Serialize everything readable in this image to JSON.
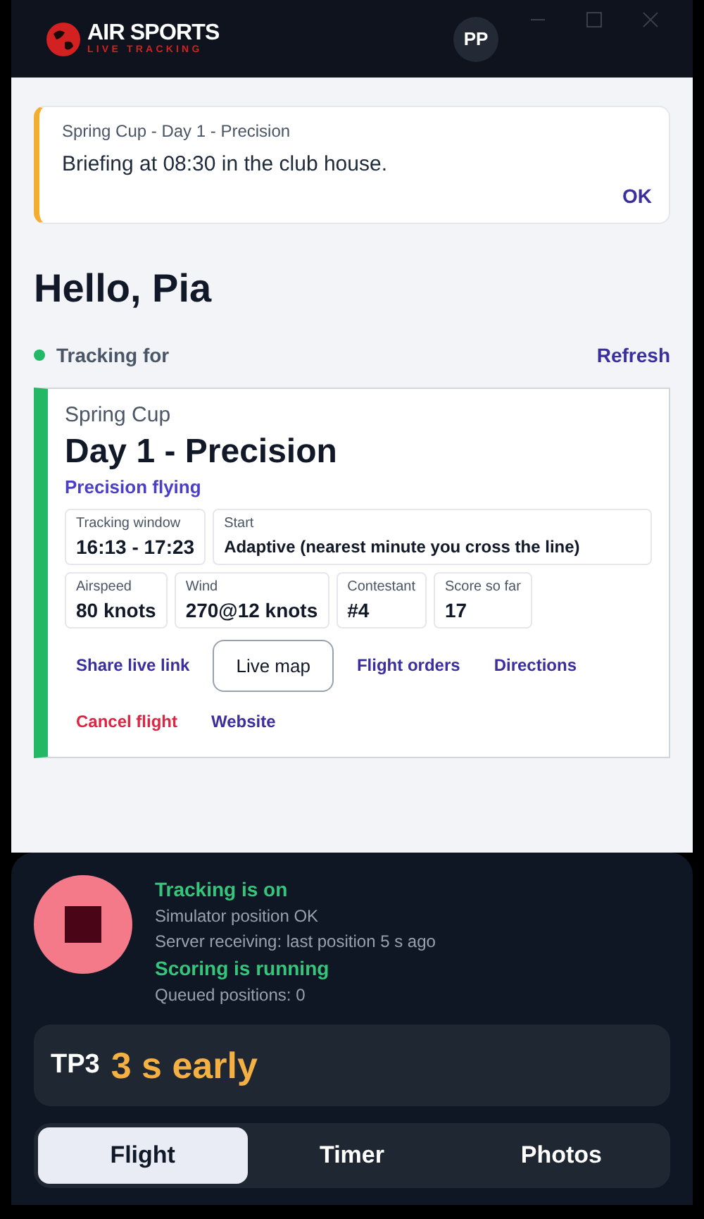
{
  "header": {
    "logo_title": "AIR SPORTS",
    "logo_subtitle": "LIVE TRACKING",
    "avatar": "PP"
  },
  "notice": {
    "title": "Spring Cup - Day 1 - Precision",
    "message": "Briefing at 08:30 in the club house.",
    "action": "OK"
  },
  "greeting": "Hello, Pia",
  "tracking_for": {
    "label": "Tracking for",
    "active": true,
    "action": "Refresh"
  },
  "flight": {
    "competition": "Spring Cup",
    "task": "Day 1 - Precision",
    "type": "Precision flying",
    "facts": [
      {
        "label": "Tracking window",
        "value": "16:13 - 17:23"
      },
      {
        "label": "Start",
        "value": "Adaptive (nearest minute you cross the line)"
      },
      {
        "label": "Airspeed",
        "value": "80 knots"
      },
      {
        "label": "Wind",
        "value": "270@12 knots"
      },
      {
        "label": "Contestant",
        "value": "#4"
      },
      {
        "label": "Score so far",
        "value": "17"
      }
    ],
    "actions": [
      {
        "label": "Share live link",
        "kind": "link"
      },
      {
        "label": "Live map",
        "kind": "button"
      },
      {
        "label": "Flight orders",
        "kind": "link"
      },
      {
        "label": "Directions",
        "kind": "link"
      },
      {
        "label": "Cancel flight",
        "kind": "danger"
      },
      {
        "label": "Website",
        "kind": "link"
      }
    ]
  },
  "status": {
    "tracking": true,
    "lines": [
      {
        "text": "Tracking is on",
        "kind": "heading"
      },
      {
        "text": "Simulator position OK",
        "kind": "detail"
      },
      {
        "text": "Server receiving: last position 5 s ago",
        "kind": "detail"
      },
      {
        "text": "Scoring is running",
        "kind": "heading"
      },
      {
        "text": "Queued positions: 0",
        "kind": "detail"
      }
    ],
    "gate": "TP3",
    "deviation": "3 s early"
  },
  "tabs": [
    {
      "label": "Flight",
      "selected": true
    },
    {
      "label": "Timer",
      "selected": false
    },
    {
      "label": "Photos",
      "selected": false
    }
  ]
}
